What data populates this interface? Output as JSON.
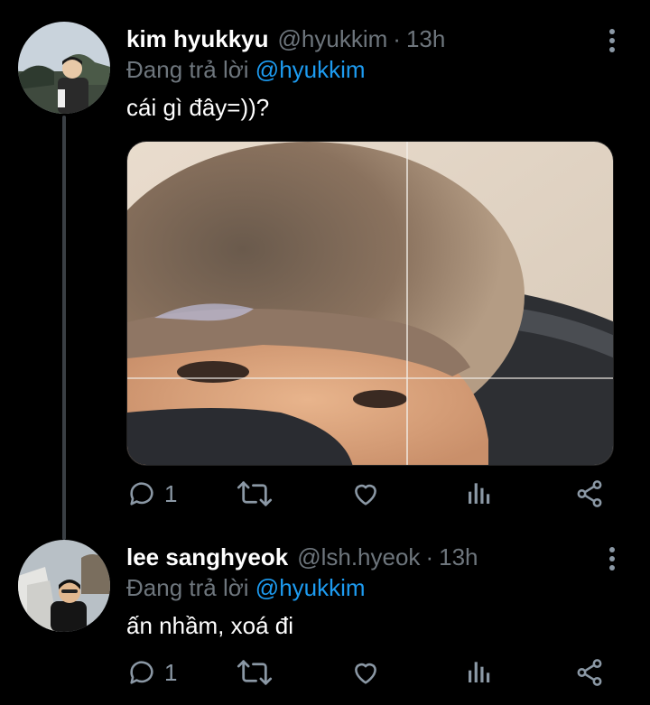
{
  "tweets": [
    {
      "name": "kim hyukkyu",
      "handle": "@hyukkim",
      "separator": "·",
      "time": "13h",
      "reply_prefix": "Đang trả lời",
      "reply_to": "@hyukkim",
      "text": "cái gì đây=))?",
      "has_media": true,
      "reply_count": "1"
    },
    {
      "name": "lee sanghyeok",
      "handle": "@lsh.hyeok",
      "separator": "·",
      "time": "13h",
      "reply_prefix": "Đang trả lời",
      "reply_to": "@hyukkim",
      "text": "ấn nhầm, xoá đi",
      "has_media": false,
      "reply_count": "1"
    }
  ],
  "icons": {
    "reply": "reply-icon",
    "retweet": "retweet-icon",
    "like": "heart-icon",
    "analytics": "analytics-icon",
    "share": "share-icon",
    "more": "more-vertical-icon"
  },
  "colors": {
    "background": "#000000",
    "secondary_text": "#6e767d",
    "mention": "#1d9bf0",
    "icon": "#8b98a5"
  }
}
